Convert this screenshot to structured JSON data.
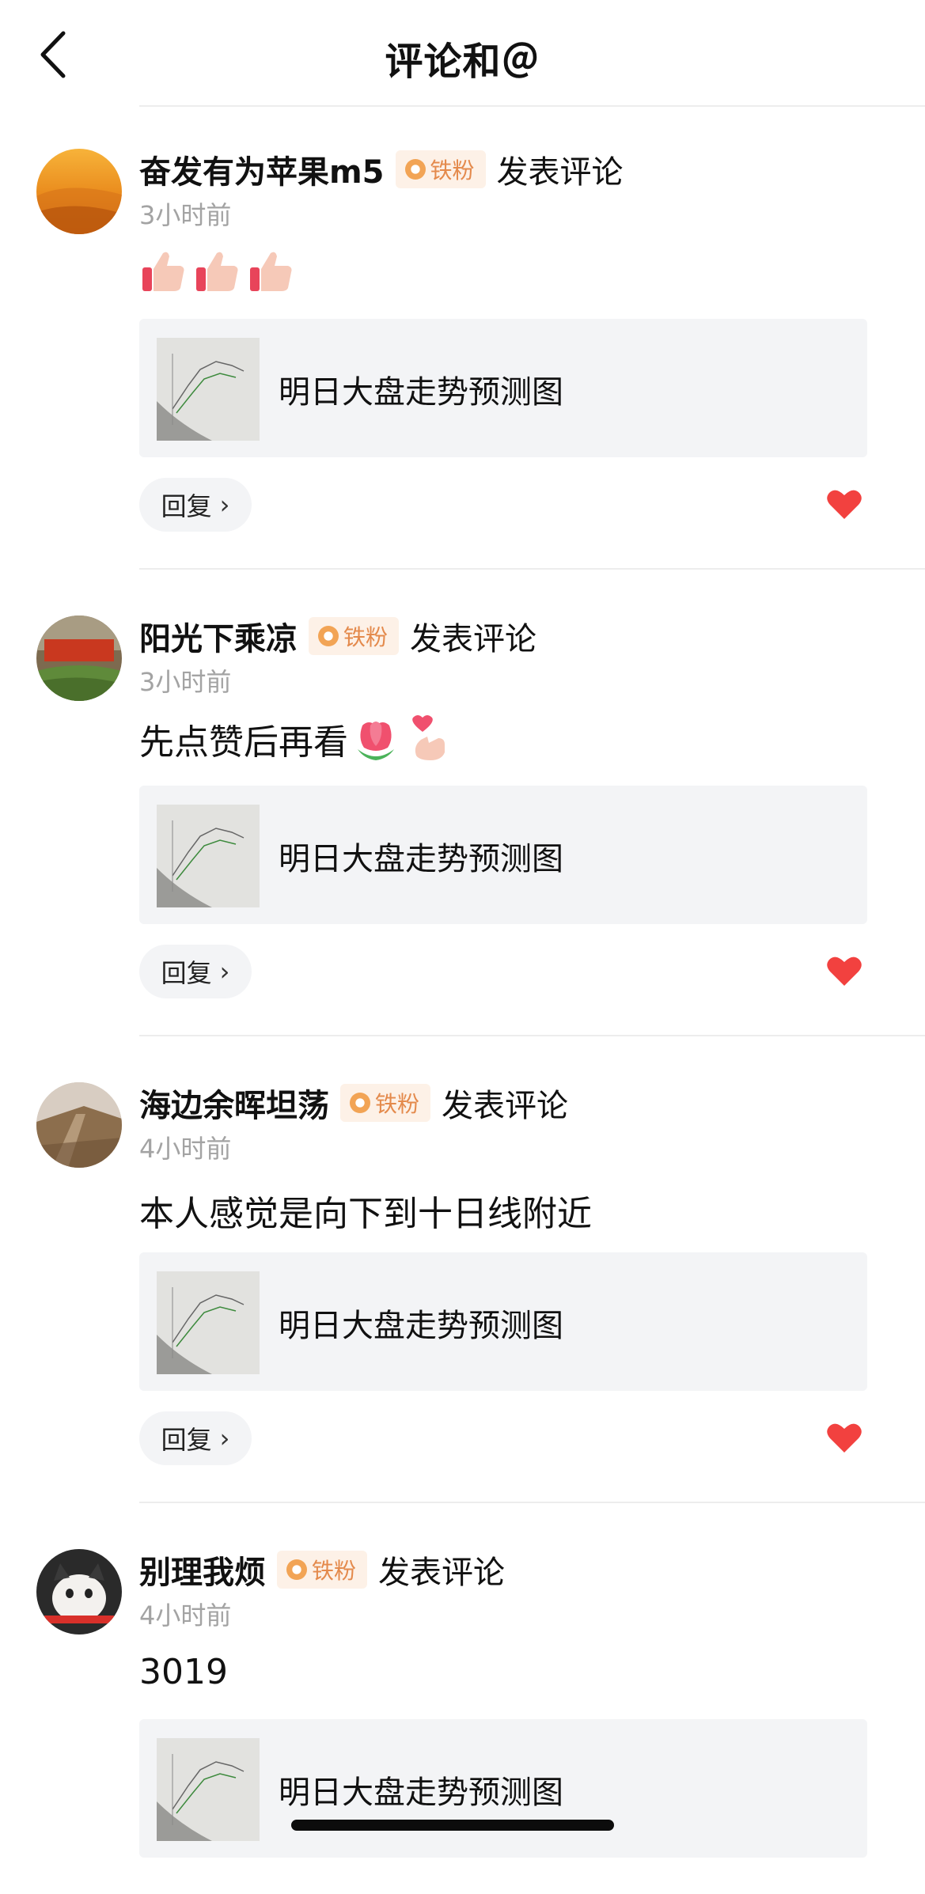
{
  "header": {
    "title": "评论和＠",
    "back_icon": "chevron-left-icon"
  },
  "comments": [
    {
      "username": "奋发有为苹果m5",
      "badge": "铁粉",
      "action": "发表评论",
      "time": "3小时前",
      "content": "",
      "emojis": [
        "thumbs-up-emoji",
        "thumbs-up-emoji",
        "thumbs-up-emoji"
      ],
      "ref_title": "明日大盘走势预测图",
      "reply_label": "回复",
      "liked": true
    },
    {
      "username": "阳光下乘凉",
      "badge": "铁粉",
      "action": "发表评论",
      "time": "3小时前",
      "content": "先点赞后再看",
      "emojis": [
        "tulip-emoji",
        "finger-heart-emoji"
      ],
      "ref_title": "明日大盘走势预测图",
      "reply_label": "回复",
      "liked": true
    },
    {
      "username": "海边余晖坦荡",
      "badge": "铁粉",
      "action": "发表评论",
      "time": "4小时前",
      "content": "本人感觉是向下到十日线附近",
      "emojis": [],
      "ref_title": "明日大盘走势预测图",
      "reply_label": "回复",
      "liked": true
    },
    {
      "username": "别理我烦",
      "badge": "铁粉",
      "action": "发表评论",
      "time": "4小时前",
      "content": "3019",
      "emojis": [],
      "ref_title": "明日大盘走势预测图",
      "reply_label": "回复",
      "liked": true
    }
  ],
  "colors": {
    "like": "#f2413f",
    "badge_text": "#e48a4c",
    "badge_bg": "#fdf1e7",
    "time": "#a3a3a3",
    "card_bg": "#f3f4f6"
  }
}
